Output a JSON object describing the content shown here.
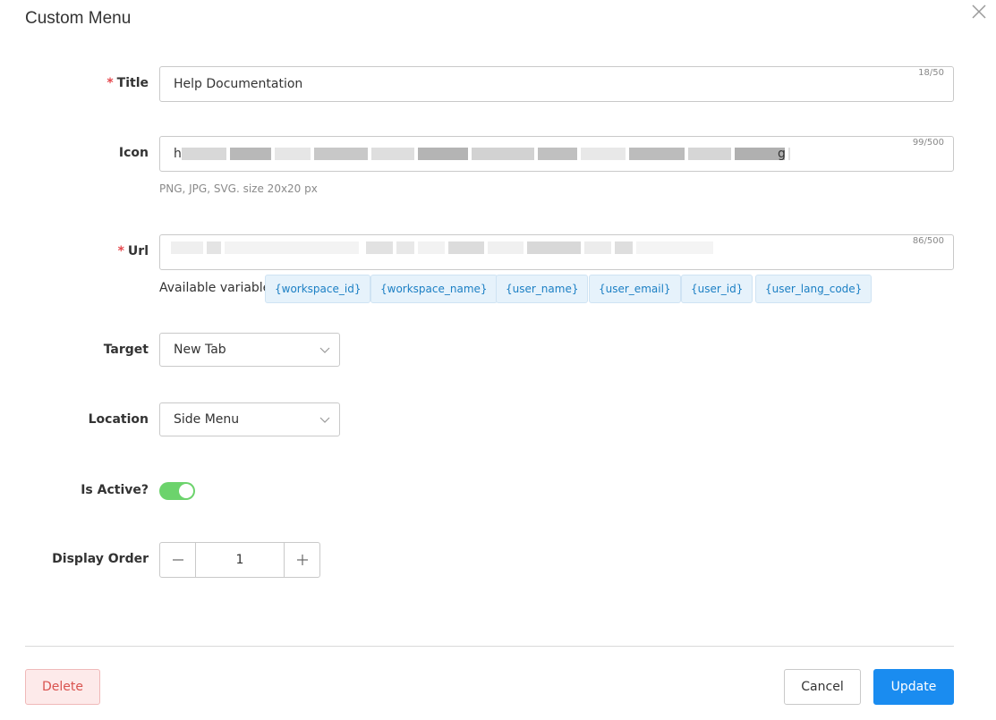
{
  "modal": {
    "title": "Custom Menu"
  },
  "form": {
    "title": {
      "label": "Title",
      "required": "*",
      "value": "Help Documentation",
      "counter": "18/50"
    },
    "icon": {
      "label": "Icon",
      "value_start": "h",
      "value_end": "g",
      "counter": "99/500",
      "hint": "PNG, JPG, SVG. size 20x20 px"
    },
    "url": {
      "label": "Url",
      "required": "*",
      "counter": "86/500",
      "available_label": "Available variable",
      "variables": [
        "{workspace_id}",
        "{workspace_name}",
        "{user_name}",
        "{user_email}",
        "{user_id}",
        "{user_lang_code}"
      ]
    },
    "target": {
      "label": "Target",
      "value": "New Tab"
    },
    "location": {
      "label": "Location",
      "value": "Side Menu"
    },
    "is_active": {
      "label": "Is Active?",
      "on": true
    },
    "display_order": {
      "label": "Display Order",
      "value": "1"
    }
  },
  "footer": {
    "delete_label": "Delete",
    "cancel_label": "Cancel",
    "update_label": "Update"
  },
  "colors": {
    "primary": "#1a8cf0",
    "toggle_on": "#6cd36c",
    "danger": "#d9534f",
    "chip_text": "#1b7fc4",
    "required": "#e5484d"
  },
  "icons": {
    "close": "close-icon",
    "chevron": "chevron-down-icon",
    "minus": "minus-icon",
    "plus": "plus-icon"
  }
}
